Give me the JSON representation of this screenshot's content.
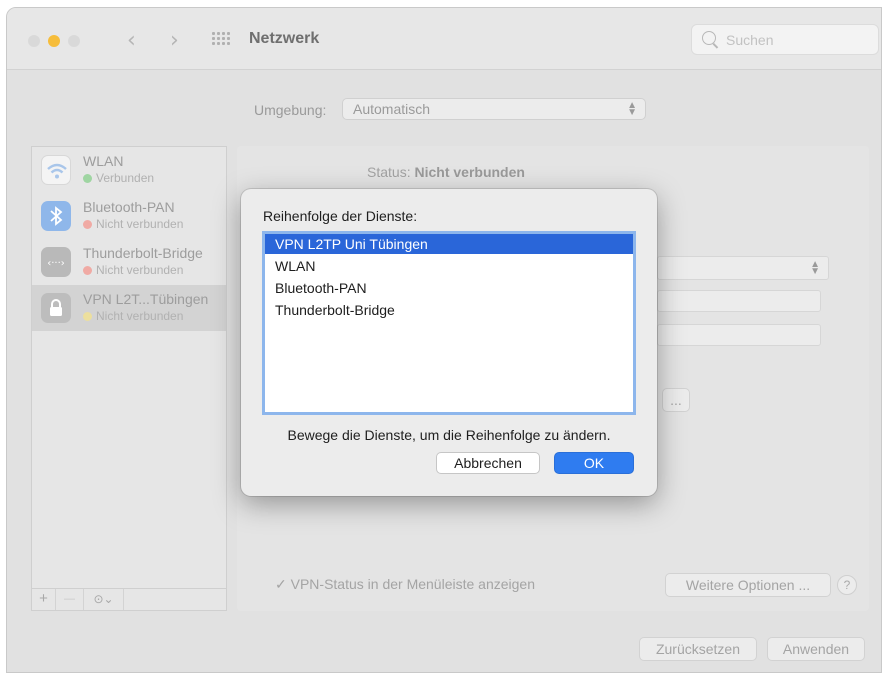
{
  "window": {
    "title": "Netzwerk"
  },
  "search": {
    "placeholder": "Suchen"
  },
  "location": {
    "label": "Umgebung:",
    "value": "Automatisch"
  },
  "sidebar": {
    "items": [
      {
        "name": "WLAN",
        "status": "Verbunden",
        "status_color": "#4cc755",
        "icon": "wifi-icon",
        "icon_color": "#f4f4f4"
      },
      {
        "name": "Bluetooth-PAN",
        "status": "Nicht verbunden",
        "status_color": "#f06a5e",
        "icon": "bluetooth-icon",
        "icon_color": "#4a8fe0"
      },
      {
        "name": "Thunderbolt-Bridge",
        "status": "Nicht verbunden",
        "status_color": "#f06a5e",
        "icon": "thunderbolt-icon",
        "icon_color": "#a0a0a0"
      },
      {
        "name": "VPN L2T...Tübingen",
        "status": "Nicht verbunden",
        "status_color": "#f2d55c",
        "icon": "lock-icon",
        "icon_color": "#a8a8a8"
      }
    ],
    "footer": {
      "add": "+",
      "remove": "—",
      "action": "⊙⌄"
    }
  },
  "panel": {
    "status_label": "Status:",
    "status_value": "Nicht verbunden",
    "connect_more": "...",
    "show_vpn_status": "VPN-Status in der Menüleiste anzeigen",
    "check_mark": "✓",
    "more_options": "Weitere Optionen ...",
    "help": "?",
    "reset": "Zurücksetzen",
    "apply": "Anwenden"
  },
  "dialog": {
    "title": "Reihenfolge der Dienste:",
    "items": [
      "VPN L2TP Uni Tübingen",
      "WLAN",
      "Bluetooth-PAN",
      "Thunderbolt-Bridge"
    ],
    "selected_index": 0,
    "hint": "Bewege die Dienste, um die Reihenfolge zu ändern.",
    "cancel": "Abbrechen",
    "ok": "OK"
  }
}
